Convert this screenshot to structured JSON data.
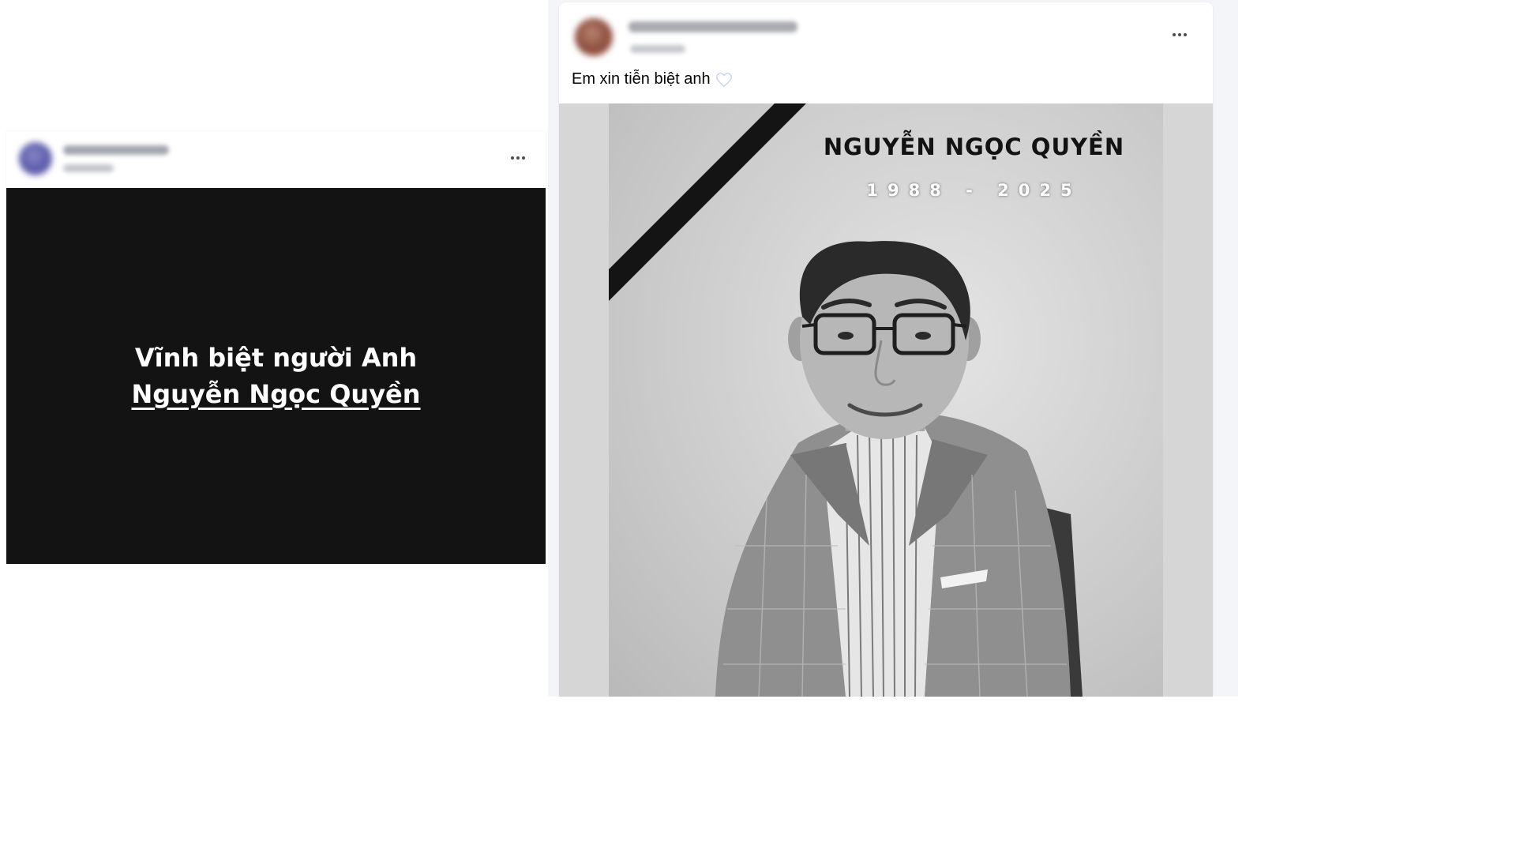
{
  "left_post": {
    "card_title_line1": "Vĩnh biệt người Anh",
    "card_title_line2": "Nguyễn Ngọc Quyền"
  },
  "right_post": {
    "caption": "Em xin tiễn biệt anh",
    "caption_emoji": "white-heart-icon",
    "photo_name": "NGUYỄN NGỌC QUYỀN",
    "photo_years": "1988 - 2025"
  },
  "colors": {
    "card_background": "#131313",
    "page_background": "#f4f5f8"
  }
}
